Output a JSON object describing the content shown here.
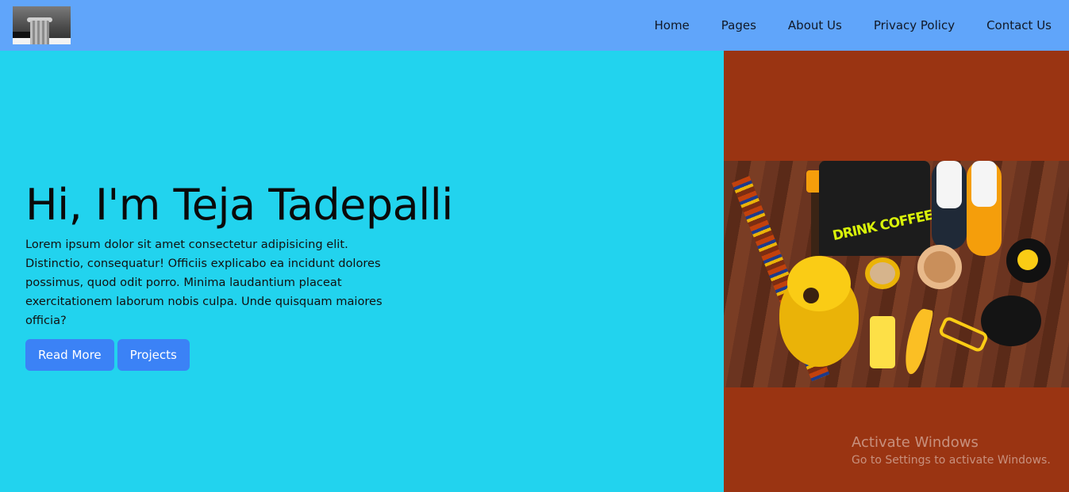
{
  "nav": {
    "logo_alt": "logo",
    "links": [
      "Home",
      "Pages",
      "About Us",
      "Privacy Policy",
      "Contact Us"
    ]
  },
  "hero": {
    "title": "Hi, I'm Teja Tadepalli",
    "text": "Lorem ipsum dolor sit amet consectetur adipisicing elit. Distinctio, consequatur! Officiis explicabo ea incidunt dolores possimus, quod odit porro. Minima laudantium placeat exercitationem laborum nobis culpa. Unde quisquam maiores officia?",
    "buttons": {
      "read_more": "Read More",
      "projects": "Projects"
    },
    "image_text": "DRINK COFFEE"
  },
  "watermark": {
    "title": "Activate Windows",
    "subtitle": "Go to Settings to activate Windows."
  },
  "colors": {
    "navbar": "#60a5fa",
    "hero_left": "#22d3ee",
    "hero_right": "#9a3412",
    "button": "#3b82f6"
  }
}
